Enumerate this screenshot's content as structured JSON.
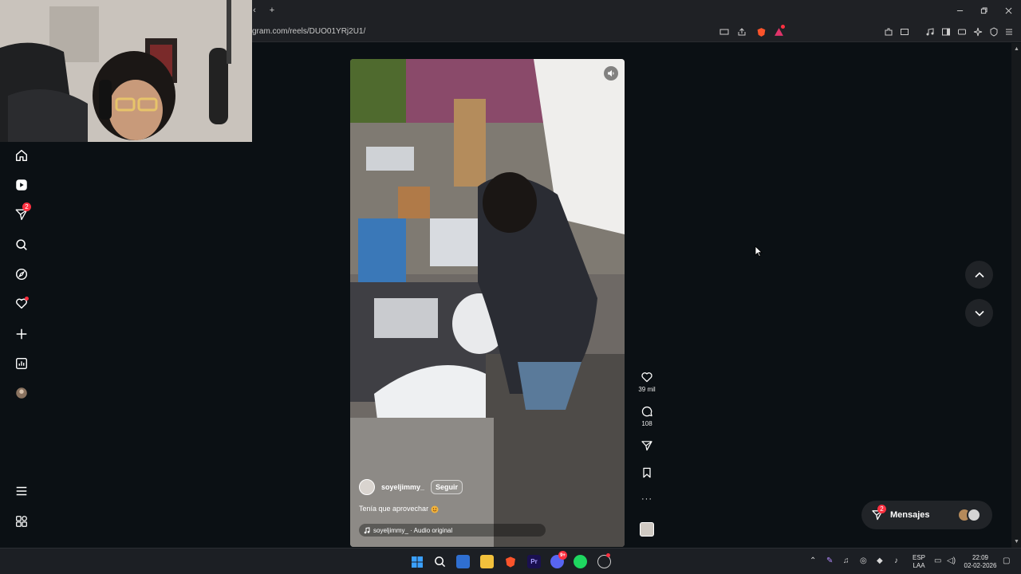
{
  "browser": {
    "url": "gram.com/reels/DUO01YRj2U1/",
    "new_tab_symbol": "+",
    "tab_back_symbol": "‹"
  },
  "nav": {
    "notifications_badge": "2",
    "items": [
      "home-icon",
      "reels-icon",
      "direct-icon",
      "search-icon",
      "explore-icon",
      "activity-icon",
      "create-icon",
      "dashboard-icon",
      "profile-avatar",
      "more-icon",
      "also-from-meta-icon"
    ]
  },
  "reel": {
    "username": "soyeljimmy_",
    "follow_label": "Seguir",
    "caption": "Tenía que aprovechar",
    "audio": "soyeljimmy_ · Audio original",
    "likes": "39 mil",
    "comments": "108",
    "more_symbol": "···"
  },
  "messages": {
    "label": "Mensajes",
    "badge": "2"
  },
  "taskbar": {
    "lang_top": "ESP",
    "lang_bottom": "LAA",
    "time": "22:09",
    "date": "02-02-2026",
    "discord_badge": "9+"
  },
  "colors": {
    "page_bg": "#0b1014",
    "badge": "#ff3040",
    "chrome_bg": "#1f2125"
  }
}
